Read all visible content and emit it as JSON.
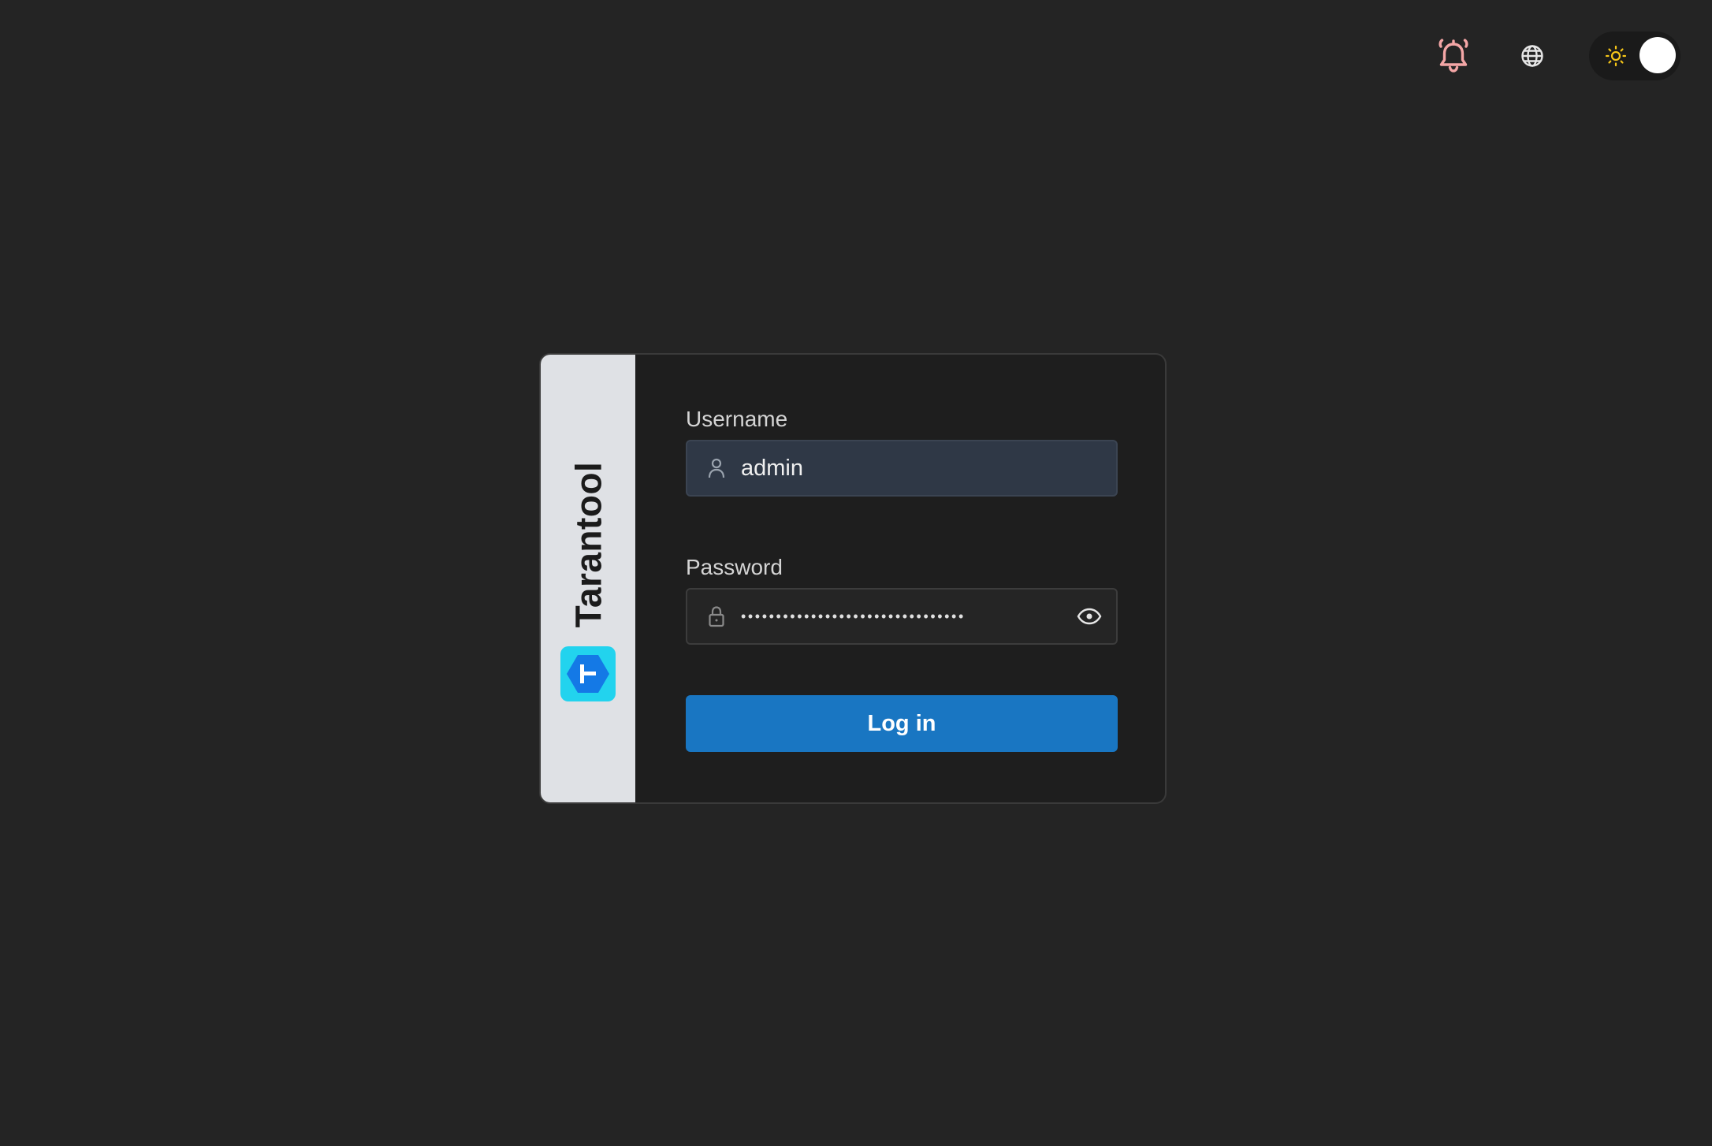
{
  "header": {
    "notifications_icon": "bell-ringing-icon",
    "language_icon": "globe-icon",
    "theme_toggle": {
      "icon": "sun-icon",
      "state": "light"
    }
  },
  "brand": {
    "name": "Tarantool",
    "logo_icon": "tarantool-logo"
  },
  "login_form": {
    "username": {
      "label": "Username",
      "value": "admin",
      "icon": "user-icon"
    },
    "password": {
      "label": "Password",
      "masked_value": "••••••••••••••••••••••••••••••••",
      "icon": "lock-icon",
      "toggle_icon": "eye-icon"
    },
    "submit_label": "Log in"
  },
  "colors": {
    "background": "#242424",
    "card": "#1e1e1e",
    "brand_strip": "#dfe1e5",
    "primary": "#1976c2",
    "bell": "#f4a6a6",
    "sun": "#f5c518",
    "logo_bg": "#22d3ee",
    "logo_fg": "#1479e6"
  }
}
